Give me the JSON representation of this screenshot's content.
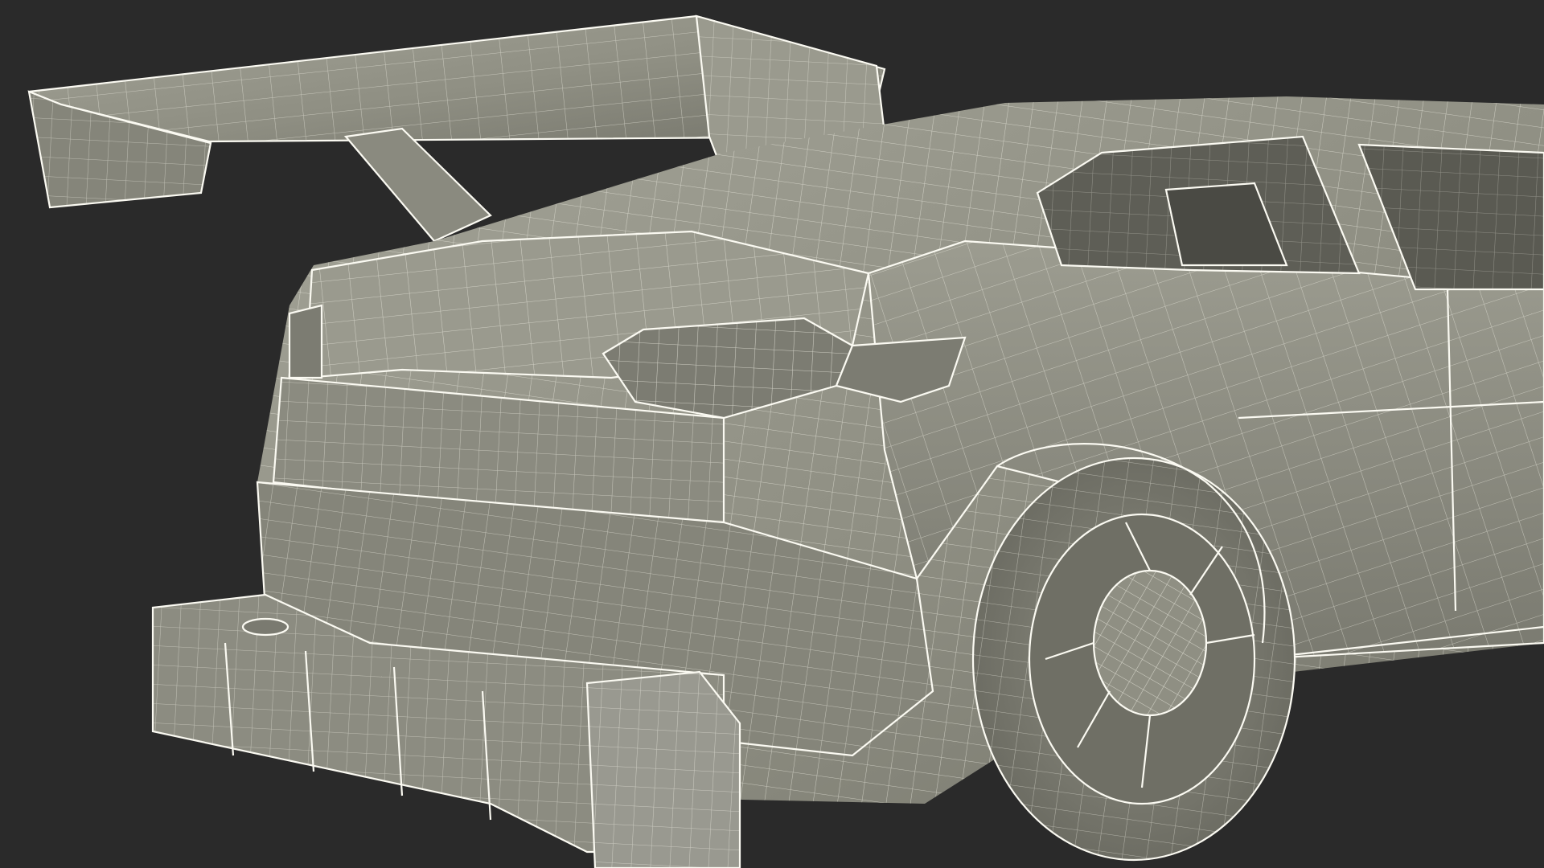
{
  "scene": {
    "subject": "wireframe-render",
    "background_color": "#2a2a2a",
    "surface_color": "#8f8f83",
    "surface_shadow_color": "#6f6f65",
    "surface_light_color": "#a7a79b",
    "wire_color": "#f2f1e6",
    "glass_color": "#5e5e56"
  }
}
